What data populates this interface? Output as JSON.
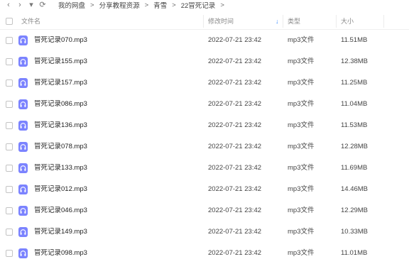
{
  "nav": {
    "back": "‹",
    "forward": "›",
    "dropdown": "▾",
    "refresh": "⟳"
  },
  "breadcrumb": {
    "items": [
      "我的网盘",
      "分享教程资源",
      "青雪",
      "22冒死记录"
    ],
    "separator": ">"
  },
  "table": {
    "headers": {
      "name": "文件名",
      "date": "修改时间",
      "type": "类型",
      "size": "大小"
    },
    "sort": {
      "column": "date",
      "direction": "desc",
      "arrow": "↓"
    },
    "rows": [
      {
        "name": "冒死记录070.mp3",
        "date": "2022-07-21 23:42",
        "type": "mp3文件",
        "size": "11.51MB"
      },
      {
        "name": "冒死记录155.mp3",
        "date": "2022-07-21 23:42",
        "type": "mp3文件",
        "size": "12.38MB"
      },
      {
        "name": "冒死记录157.mp3",
        "date": "2022-07-21 23:42",
        "type": "mp3文件",
        "size": "11.25MB"
      },
      {
        "name": "冒死记录086.mp3",
        "date": "2022-07-21 23:42",
        "type": "mp3文件",
        "size": "11.04MB"
      },
      {
        "name": "冒死记录136.mp3",
        "date": "2022-07-21 23:42",
        "type": "mp3文件",
        "size": "11.53MB"
      },
      {
        "name": "冒死记录078.mp3",
        "date": "2022-07-21 23:42",
        "type": "mp3文件",
        "size": "12.28MB"
      },
      {
        "name": "冒死记录133.mp3",
        "date": "2022-07-21 23:42",
        "type": "mp3文件",
        "size": "11.69MB"
      },
      {
        "name": "冒死记录012.mp3",
        "date": "2022-07-21 23:42",
        "type": "mp3文件",
        "size": "14.46MB"
      },
      {
        "name": "冒死记录046.mp3",
        "date": "2022-07-21 23:42",
        "type": "mp3文件",
        "size": "12.29MB"
      },
      {
        "name": "冒死记录149.mp3",
        "date": "2022-07-21 23:42",
        "type": "mp3文件",
        "size": "10.33MB"
      },
      {
        "name": "冒死记录098.mp3",
        "date": "2022-07-21 23:42",
        "type": "mp3文件",
        "size": "11.01MB"
      }
    ]
  },
  "colors": {
    "accent": "#3b8cff",
    "file_icon": "#7b83ff"
  },
  "icons": {
    "file": "headphones-icon"
  }
}
